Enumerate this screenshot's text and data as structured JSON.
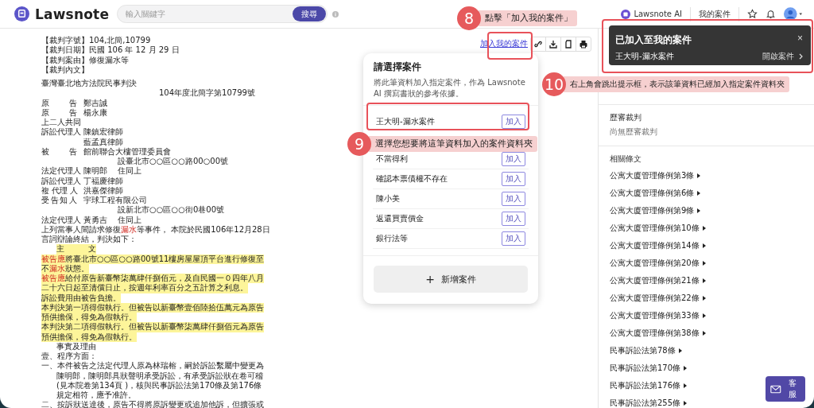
{
  "header": {
    "logo": "Lawsnote",
    "search": {
      "placeholder": "輸入關鍵字",
      "button": "搜尋"
    },
    "ai_link": "Lawsnote AI",
    "my_cases": "我的案件"
  },
  "toolbar": {
    "add_link": "加入我的案件"
  },
  "document": [
    {
      "kind": "plain",
      "highlight": false,
      "text": "【裁判字號】104,北簡,10799"
    },
    {
      "kind": "plain",
      "highlight": false,
      "text": "【裁判日期】民國 106 年 12 月 29 日"
    },
    {
      "kind": "plain",
      "highlight": false,
      "text": "【裁判案由】修復漏水等"
    },
    {
      "kind": "plain",
      "highlight": false,
      "text": "【裁判內文】"
    },
    {
      "kind": "gap",
      "highlight": false,
      "text": "臺灣臺北地方法院民事判決"
    },
    {
      "kind": "court-number",
      "highlight": false,
      "text": "104年度北簡字第10799號"
    },
    {
      "kind": "party",
      "label": "原告",
      "name": "鄭吉誠"
    },
    {
      "kind": "party",
      "label": "原告",
      "name": "楊永康"
    },
    {
      "kind": "plain",
      "highlight": false,
      "text": "上二人共同"
    },
    {
      "kind": "party",
      "label": "訴訟代理人",
      "name": "陳鎮宏律師"
    },
    {
      "kind": "party",
      "name": "藍孟真律師"
    },
    {
      "kind": "party",
      "label": "被告",
      "name": "館前聯合大樓管理委員會"
    },
    {
      "kind": "address",
      "highlight": false,
      "text": "設臺北市○○區○○路00○00號"
    },
    {
      "kind": "party",
      "label": "法定代理人",
      "name": "陳明郎",
      "extra": "住同上"
    },
    {
      "kind": "party",
      "label": "訴訟代理人",
      "name": "丁福慶律師"
    },
    {
      "kind": "party",
      "label": "複 代理 人",
      "name": "洪嘉傑律師"
    },
    {
      "kind": "party",
      "label": "受告知人",
      "name": "宇球工程有限公司"
    },
    {
      "kind": "address",
      "highlight": false,
      "text": "設新北市○○區○○街0巷00號"
    },
    {
      "kind": "party",
      "label": "法定代理人",
      "name": "黃勇吉",
      "extra": "住同上"
    },
    {
      "kind": "plain",
      "highlight": false,
      "parts": [
        {
          "text": "上列當事人間請求修復",
          "red": false
        },
        {
          "text": "漏水",
          "red": true
        },
        {
          "text": "等事件， 本院於民國106年12月28日",
          "red": false
        }
      ]
    },
    {
      "kind": "plain",
      "highlight": false,
      "text": "言詞辯論終結，判決如下："
    },
    {
      "kind": "indent",
      "highlight": true,
      "text": "主　　　文"
    },
    {
      "kind": "plain",
      "highlight": true,
      "parts": [
        {
          "text": "被告應",
          "red": true
        },
        {
          "text": "將臺北市○○區○○路00號11樓房屋屋頂平台進行修復至",
          "red": false
        }
      ]
    },
    {
      "kind": "plain",
      "highlight": true,
      "parts": [
        {
          "text": "不",
          "red": false
        },
        {
          "text": "漏水",
          "red": true
        },
        {
          "text": "狀態。",
          "red": false
        }
      ]
    },
    {
      "kind": "plain",
      "highlight": true,
      "parts": [
        {
          "text": "被告應",
          "red": true
        },
        {
          "text": "給付原告新臺幣柒萬肆仟捌佰元，及自民國一０四年八月",
          "red": false
        }
      ]
    },
    {
      "kind": "plain",
      "highlight": true,
      "text": "二十六日起至清償日止，按週年利率百分之五計算之利息。"
    },
    {
      "kind": "plain",
      "highlight": true,
      "text": "訴訟費用由被告負擔。"
    },
    {
      "kind": "plain",
      "highlight": true,
      "text": "本判決第一項得假執行。但被告以新臺幣壹佰陸拾伍萬元為原告"
    },
    {
      "kind": "plain",
      "highlight": true,
      "text": "預供擔保，得免為假執行。"
    },
    {
      "kind": "plain",
      "highlight": true,
      "text": "本判決第二項得假執行。但被告以新臺幣柒萬肆仟捌佰元為原告"
    },
    {
      "kind": "plain",
      "highlight": true,
      "text": "預供擔保，得免為假執行。"
    },
    {
      "kind": "indent",
      "highlight": false,
      "text": "事實及理由"
    },
    {
      "kind": "plain",
      "highlight": false,
      "text": "壹、程序方面："
    },
    {
      "kind": "plain",
      "highlight": false,
      "text": "一、本件被告之法定代理人原為林瑞榕，嗣於訴訟繫屬中變更為"
    },
    {
      "kind": "indent",
      "highlight": false,
      "text": "陳明郎，陳明郎具狀聲明承受訴訟，有承受訴訟狀在卷可稽"
    },
    {
      "kind": "indent",
      "highlight": false,
      "text": "(見本院卷第134頁 )，核與民事訴訟法第170條及第176條"
    },
    {
      "kind": "indent",
      "highlight": false,
      "text": "規定相符，應予准許。"
    },
    {
      "kind": "plain",
      "highlight": false,
      "text": "二、按訴狀送達後，原告不得將原訴變更或追加他訴，但擴張或"
    }
  ],
  "case_picker": {
    "title": "請選擇案件",
    "description": "將此筆資料加入指定案件，作為 Lawsnote AI 撰寫書狀的參考依據。",
    "cases": [
      {
        "name": "王大明-漏水案件",
        "button": "加入"
      },
      {
        "name": "不當得利",
        "button": "加入"
      },
      {
        "name": "確認本票債權不存在",
        "button": "加入"
      },
      {
        "name": "陳小美",
        "button": "加入"
      },
      {
        "name": "返還買賣價金",
        "button": "加入"
      },
      {
        "name": "銀行法等",
        "button": "加入"
      }
    ],
    "new_case": "新增案件",
    "new_case_icon": "+"
  },
  "toast": {
    "title": "已加入至我的案件",
    "case": "王大明-漏水案件",
    "open": "開啟案件",
    "close": "×"
  },
  "sidebar": {
    "history_title": "歷審裁判",
    "history_empty": "尚無歷審裁判",
    "laws_title": "相關條文",
    "laws": [
      "公寓大廈管理條例第3條",
      "公寓大廈管理條例第6條",
      "公寓大廈管理條例第9條",
      "公寓大廈管理條例第10條",
      "公寓大廈管理條例第14條",
      "公寓大廈管理條例第20條",
      "公寓大廈管理條例第21條",
      "公寓大廈管理條例第22條",
      "公寓大廈管理條例第33條",
      "公寓大廈管理條例第38條",
      "民事訴訟法第78條",
      "民事訴訟法第170條",
      "民事訴訟法第176條",
      "民事訴訟法第255條"
    ]
  },
  "support_button": "客服",
  "annotations": [
    {
      "number": "8",
      "text": "點擊「加入我的案件」"
    },
    {
      "number": "9",
      "text": "選擇您想要將這筆資料加入的案件資料夾"
    },
    {
      "number": "10",
      "text": "右上角會跳出提示框，表示該筆資料已經加入指定案件資料夾"
    }
  ]
}
